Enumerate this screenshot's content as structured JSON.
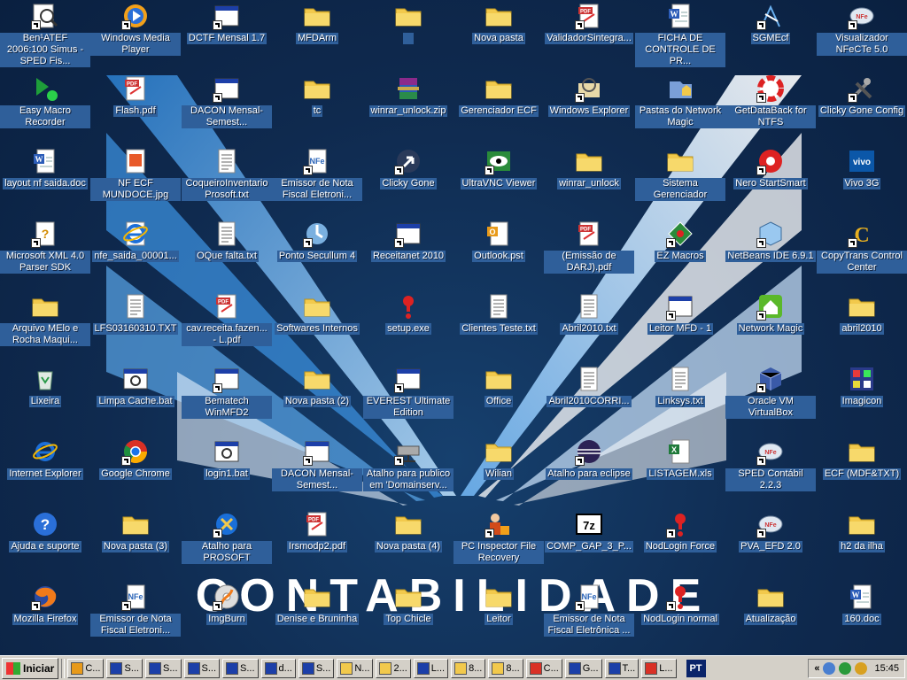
{
  "colors": {
    "desktop": "#0f2a4f",
    "label_bg": "#2f5f9a",
    "taskbar": "#d4d0c8"
  },
  "wallpaper": {
    "text": "CONTABILIDADE"
  },
  "icons": [
    {
      "label": "Ben¹ATEF 2006:100 Simus - SPED Fis...",
      "icon": "magnifier-icon",
      "shortcut": true
    },
    {
      "label": "Windows Media Player",
      "icon": "media-player-icon",
      "shortcut": true
    },
    {
      "label": "DCTF Mensal 1.7",
      "icon": "window-icon",
      "shortcut": true
    },
    {
      "label": "MFDArm",
      "icon": "folder-icon",
      "shortcut": false
    },
    {
      "label": "",
      "icon": "folder-icon",
      "shortcut": false
    },
    {
      "label": "Nova pasta",
      "icon": "folder-icon",
      "shortcut": false
    },
    {
      "label": "ValidadorSintegra...",
      "icon": "pdf-icon",
      "shortcut": true
    },
    {
      "label": "FICHA DE CONTROLE DE PR...",
      "icon": "word-doc-icon",
      "shortcut": false
    },
    {
      "label": "SGMEcf",
      "icon": "sgm-icon",
      "shortcut": true
    },
    {
      "label": "Visualizador NFeCTe 5.0",
      "icon": "globe-icon",
      "shortcut": true
    },
    {
      "label": "Easy Macro Recorder",
      "icon": "macro-icon",
      "shortcut": false
    },
    {
      "label": "Flash.pdf",
      "icon": "pdf-icon",
      "shortcut": false
    },
    {
      "label": "DACON Mensal-Semest...",
      "icon": "window-icon",
      "shortcut": true
    },
    {
      "label": "tc",
      "icon": "folder-icon",
      "shortcut": false
    },
    {
      "label": "winrar_unlock.zip",
      "icon": "winrar-icon",
      "shortcut": false
    },
    {
      "label": "Gerenciador ECF",
      "icon": "folder-icon",
      "shortcut": false
    },
    {
      "label": "Windows Explorer",
      "icon": "explorer-icon",
      "shortcut": true
    },
    {
      "label": "Pastas do Network Magic",
      "icon": "network-folder-icon",
      "shortcut": false
    },
    {
      "label": "GetDataBack for NTFS",
      "icon": "lifebuoy-icon",
      "shortcut": true
    },
    {
      "label": "Clicky Gone Config",
      "icon": "tools-icon",
      "shortcut": true
    },
    {
      "label": "layout nf saida.doc",
      "icon": "word-doc-icon",
      "shortcut": false
    },
    {
      "label": "NF ECF MUNDOCE.jpg",
      "icon": "image-icon",
      "shortcut": false
    },
    {
      "label": "CoqueiroInventario Prosoft.txt",
      "icon": "text-file-icon",
      "shortcut": false
    },
    {
      "label": "Emissor de Nota Fiscal Eletroni...",
      "icon": "nfe-icon",
      "shortcut": true
    },
    {
      "label": "Clicky Gone",
      "icon": "cursor-icon",
      "shortcut": true
    },
    {
      "label": "UltraVNC Viewer",
      "icon": "vnc-eye-icon",
      "shortcut": true
    },
    {
      "label": "winrar_unlock",
      "icon": "folder-icon",
      "shortcut": false
    },
    {
      "label": "Sistema Gerenciador",
      "icon": "folder-icon",
      "shortcut": false
    },
    {
      "label": "Nero StartSmart",
      "icon": "nero-icon",
      "shortcut": true
    },
    {
      "label": "Vivo 3G",
      "icon": "vivo-icon",
      "shortcut": false
    },
    {
      "label": "Microsoft XML 4.0 Parser SDK",
      "icon": "help-doc-icon",
      "shortcut": true
    },
    {
      "label": "nfe_saida_00001...",
      "icon": "ie-doc-icon",
      "shortcut": false
    },
    {
      "label": "OQue falta.txt",
      "icon": "text-file-icon",
      "shortcut": false
    },
    {
      "label": "Ponto Secullum 4",
      "icon": "secullum-icon",
      "shortcut": true
    },
    {
      "label": "Receitanet 2010",
      "icon": "window-icon",
      "shortcut": true
    },
    {
      "label": "Outlook.pst",
      "icon": "outlook-file-icon",
      "shortcut": false
    },
    {
      "label": "(Emissão de DARJ).pdf",
      "icon": "pdf-icon",
      "shortcut": false
    },
    {
      "label": "EZ Macros",
      "icon": "ez-macros-icon",
      "shortcut": true
    },
    {
      "label": "NetBeans IDE 6.9.1",
      "icon": "netbeans-icon",
      "shortcut": true
    },
    {
      "label": "CopyTrans Control Center",
      "icon": "copytrans-icon",
      "shortcut": true
    },
    {
      "label": "Arquivo MElo e Rocha Maqui...",
      "icon": "folder-icon",
      "shortcut": false
    },
    {
      "label": "LFS03160310.TXT",
      "icon": "text-file-icon",
      "shortcut": false
    },
    {
      "label": "cav.receita.fazen... - L.pdf",
      "icon": "pdf-icon",
      "shortcut": false
    },
    {
      "label": "Softwares Internos",
      "icon": "folder-icon",
      "shortcut": false
    },
    {
      "label": "setup.exe",
      "icon": "exclamation-icon",
      "shortcut": false
    },
    {
      "label": "Clientes Teste.txt",
      "icon": "text-file-icon",
      "shortcut": false
    },
    {
      "label": "Abril2010.txt",
      "icon": "text-file-icon",
      "shortcut": false
    },
    {
      "label": "Leitor MFD - 1",
      "icon": "window-icon",
      "shortcut": true
    },
    {
      "label": "Network Magic",
      "icon": "network-magic-icon",
      "shortcut": true
    },
    {
      "label": "abril2010",
      "icon": "folder-icon",
      "shortcut": false
    },
    {
      "label": "Lixeira",
      "icon": "recycle-bin-icon",
      "shortcut": false
    },
    {
      "label": "Limpa Cache.bat",
      "icon": "batch-file-icon",
      "shortcut": false
    },
    {
      "label": "Bematech WinMFD2",
      "icon": "window-icon",
      "shortcut": true
    },
    {
      "label": "Nova pasta (2)",
      "icon": "folder-icon",
      "shortcut": false
    },
    {
      "label": "EVEREST Ultimate Edition",
      "icon": "window-icon",
      "shortcut": true
    },
    {
      "label": "Office",
      "icon": "folder-icon",
      "shortcut": false
    },
    {
      "label": "Abril2010CORRI...",
      "icon": "text-file-icon",
      "shortcut": false
    },
    {
      "label": "Linksys.txt",
      "icon": "text-file-icon",
      "shortcut": false
    },
    {
      "label": "Oracle VM VirtualBox",
      "icon": "virtualbox-icon",
      "shortcut": true
    },
    {
      "label": "Imagicon",
      "icon": "imagicon-icon",
      "shortcut": false
    },
    {
      "label": "Internet Explorer",
      "icon": "ie-icon",
      "shortcut": false
    },
    {
      "label": "Google Chrome",
      "icon": "chrome-icon",
      "shortcut": true
    },
    {
      "label": "login1.bat",
      "icon": "batch-file-icon",
      "shortcut": false
    },
    {
      "label": "DACON Mensal-Semest...",
      "icon": "window-icon",
      "shortcut": true
    },
    {
      "label": "Atalho para publico em 'Domainserv...",
      "icon": "network-drive-icon",
      "shortcut": true
    },
    {
      "label": "Wilian",
      "icon": "folder-icon",
      "shortcut": false
    },
    {
      "label": "Atalho para eclipse",
      "icon": "eclipse-icon",
      "shortcut": true
    },
    {
      "label": "LISTAGEM.xls",
      "icon": "excel-icon",
      "shortcut": false
    },
    {
      "label": "SPED Contábil 2.2.3",
      "icon": "globe-icon",
      "shortcut": true
    },
    {
      "label": "ECF (MDF&TXT)",
      "icon": "folder-icon",
      "shortcut": false
    },
    {
      "label": "Ajuda e suporte",
      "icon": "help-icon",
      "shortcut": false
    },
    {
      "label": "Nova pasta (3)",
      "icon": "folder-icon",
      "shortcut": false
    },
    {
      "label": "Atalho para PROSOFT",
      "icon": "prosoft-icon",
      "shortcut": true
    },
    {
      "label": "Irsmodp2.pdf",
      "icon": "pdf-icon",
      "shortcut": false
    },
    {
      "label": "Nova pasta (4)",
      "icon": "folder-icon",
      "shortcut": false
    },
    {
      "label": "PC Inspector File Recovery",
      "icon": "pc-inspector-icon",
      "shortcut": true
    },
    {
      "label": "COMP_GAP_3_P...",
      "icon": "7zip-icon",
      "shortcut": false
    },
    {
      "label": "NodLogin Force",
      "icon": "exclamation-icon",
      "shortcut": true
    },
    {
      "label": "PVA_EFD 2.0",
      "icon": "globe-icon",
      "shortcut": true
    },
    {
      "label": "h2 da ilha",
      "icon": "folder-icon",
      "shortcut": false
    },
    {
      "label": "Mozilla Firefox",
      "icon": "firefox-icon",
      "shortcut": true
    },
    {
      "label": "Emissor de Nota Fiscal Eletroni...",
      "icon": "nfe-icon",
      "shortcut": true
    },
    {
      "label": "ImgBurn",
      "icon": "imgburn-icon",
      "shortcut": true
    },
    {
      "label": "Denise e Bruninha",
      "icon": "folder-icon",
      "shortcut": false
    },
    {
      "label": "Top Chicle",
      "icon": "folder-icon",
      "shortcut": false
    },
    {
      "label": "Leitor",
      "icon": "folder-icon",
      "shortcut": false
    },
    {
      "label": "Emissor de Nota Fiscal Eletrônica ...",
      "icon": "nfe-icon",
      "shortcut": true
    },
    {
      "label": "NodLogin normal",
      "icon": "exclamation-icon",
      "shortcut": true
    },
    {
      "label": "Atualização",
      "icon": "folder-icon",
      "shortcut": false
    },
    {
      "label": "160.doc",
      "icon": "word-doc-icon",
      "shortcut": false
    }
  ],
  "taskbar": {
    "start_label": "Iniciar",
    "buttons": [
      {
        "label": "C...",
        "icon": "outlook-icon"
      },
      {
        "label": "S...",
        "icon": "app-icon"
      },
      {
        "label": "S...",
        "icon": "app-icon"
      },
      {
        "label": "S...",
        "icon": "app-icon"
      },
      {
        "label": "S...",
        "icon": "app-icon"
      },
      {
        "label": "d...",
        "icon": "app-icon"
      },
      {
        "label": "S...",
        "icon": "app-icon"
      },
      {
        "label": "N...",
        "icon": "folder-icon"
      },
      {
        "label": "2...",
        "icon": "folder-icon"
      },
      {
        "label": "L...",
        "icon": "app-icon"
      },
      {
        "label": "8...",
        "icon": "folder-icon"
      },
      {
        "label": "8...",
        "icon": "folder-icon"
      },
      {
        "label": "C...",
        "icon": "chrome-icon"
      },
      {
        "label": "G...",
        "icon": "app-icon"
      },
      {
        "label": "T...",
        "icon": "app-icon"
      },
      {
        "label": "L...",
        "icon": "chrome-icon"
      }
    ],
    "language": "PT",
    "tray_expand": "«",
    "clock": "15:45"
  }
}
